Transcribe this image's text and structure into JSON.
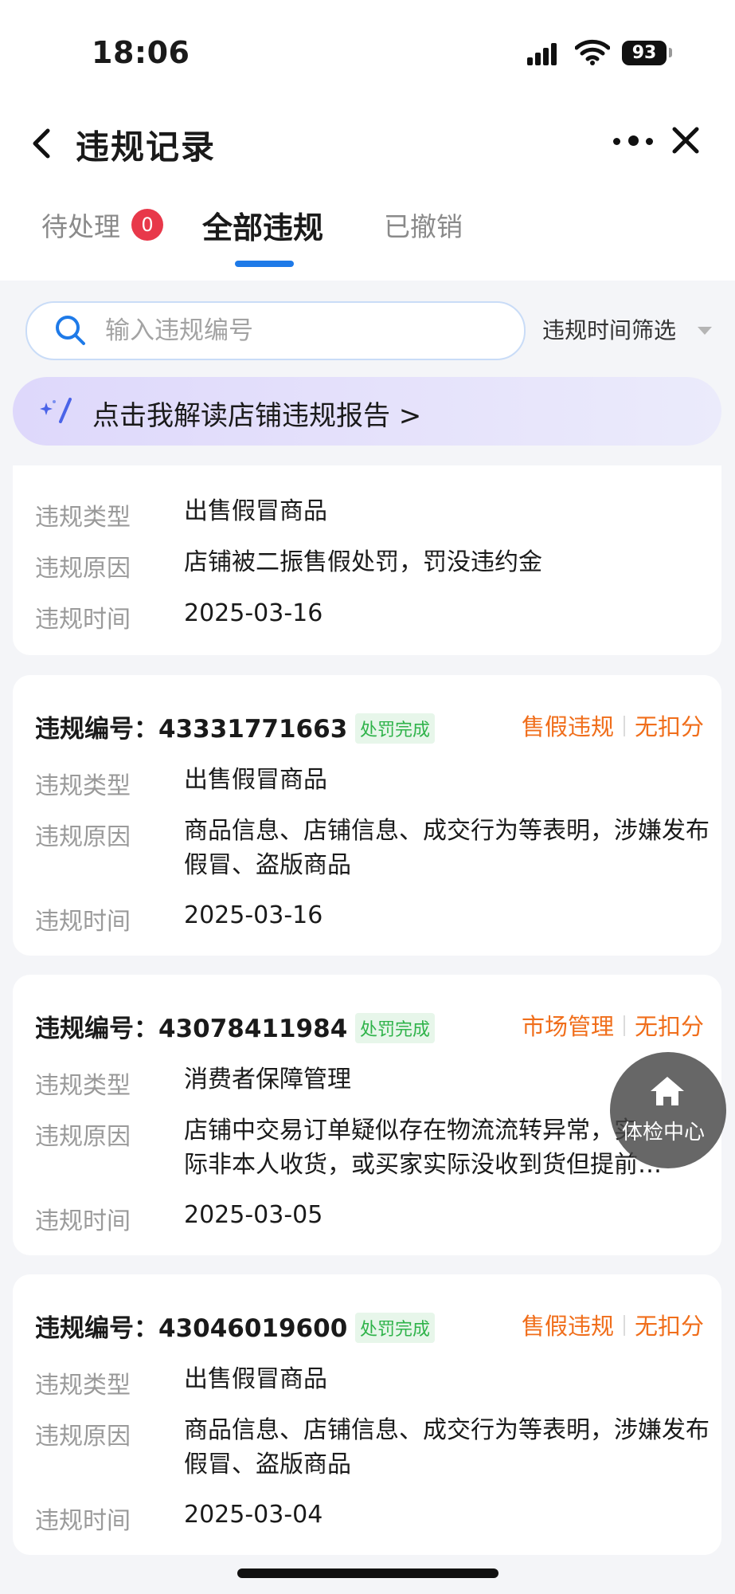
{
  "status_bar": {
    "time": "18:06",
    "battery": "93"
  },
  "header": {
    "title": "违规记录"
  },
  "tabs": [
    {
      "label": "待处理",
      "badge": "0"
    },
    {
      "label": "全部违规"
    },
    {
      "label": "已撤销"
    }
  ],
  "search": {
    "placeholder": "输入违规编号",
    "value": ""
  },
  "filter": {
    "label": "违规时间筛选"
  },
  "banner": {
    "text": "点击我解读店铺违规报告 >"
  },
  "labels": {
    "type": "违规类型",
    "reason": "违规原因",
    "time": "违规时间",
    "id_prefix": "违规编号："
  },
  "cards": [
    {
      "type": "出售假冒商品",
      "reason": "店铺被二振售假处罚，罚没违约金",
      "time": "2025-03-16"
    },
    {
      "id": "43331771663",
      "status": "处罚完成",
      "category": "售假违规",
      "points": "无扣分",
      "type": "出售假冒商品",
      "reason": "商品信息、店铺信息、成交行为等表明，涉嫌发布假冒、盗版商品",
      "time": "2025-03-16"
    },
    {
      "id": "43078411984",
      "status": "处罚完成",
      "category": "市场管理",
      "points": "无扣分",
      "type": "消费者保障管理",
      "reason_line1": "店铺中交易订单疑似存在物流流转异常，实",
      "reason_line2": "际非本人收货，或买家实际没收到货但提前…",
      "time": "2025-03-05"
    },
    {
      "id": "43046019600",
      "status": "处罚完成",
      "category": "售假违规",
      "points": "无扣分",
      "type": "出售假冒商品",
      "reason": "商品信息、店铺信息、成交行为等表明，涉嫌发布假冒、盗版商品",
      "time": "2025-03-04"
    }
  ],
  "fab": {
    "label": "体检中心",
    "icon": "home-icon"
  },
  "colors": {
    "accent": "#1e7ae8",
    "badge": "#e8384a",
    "tag": "#f06e1b",
    "status_green": "#2fb34a"
  }
}
